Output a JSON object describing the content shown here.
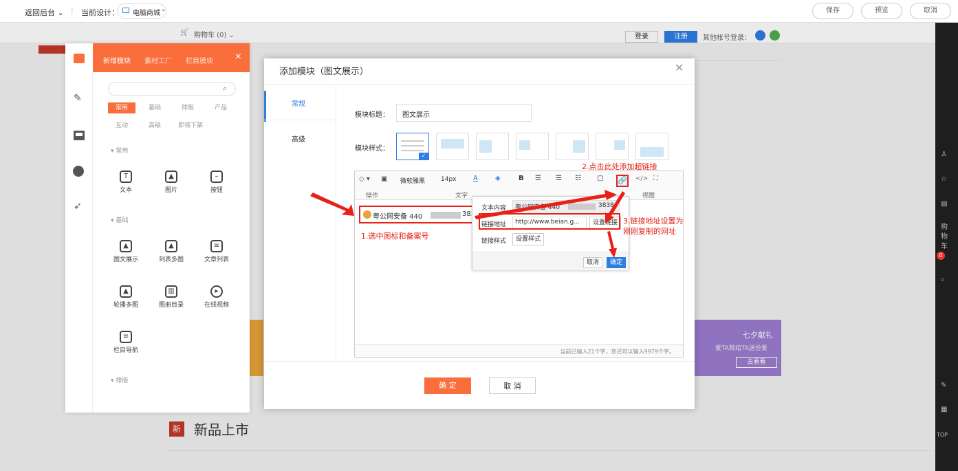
{
  "topbar": {
    "back": "返回后台 ⌄",
    "current_design_label": "当前设计：",
    "current_design_value": "电脑商城",
    "save": "保存",
    "preview": "预览",
    "cancel": "取消"
  },
  "site": {
    "cart": "购物车 (0) ⌄",
    "login": "登录",
    "register": "注册",
    "other_login": "其他帐号登录：",
    "new_products": "新品上市",
    "promo_title": "七夕献礼",
    "promo_sub": "爱TA就给TA送份爱",
    "promo_btn": "去看看"
  },
  "panel": {
    "tabs": [
      "新增模块",
      "素材工厂",
      "栏目模块"
    ],
    "categories": [
      "常用",
      "基础",
      "排版",
      "产品",
      "互动",
      "高级",
      "即将下架"
    ],
    "section_common": "常用",
    "section_basic": "基础",
    "section_layout": "排版",
    "common_modules": [
      "文本",
      "图片",
      "按钮"
    ],
    "basic_modules": [
      "图文展示",
      "列表多图",
      "文章列表",
      "轮播多图",
      "图册目录",
      "在线视频",
      "栏目导航"
    ]
  },
  "rightbar": [
    "购",
    "物",
    "车",
    "0",
    "TOP"
  ],
  "dialog": {
    "title": "添加模块（图文展示）",
    "side_tabs": [
      "常规",
      "高级"
    ],
    "label_title": "模块标题：",
    "title_value": "图文展示",
    "label_style": "模块样式：",
    "toolbar": {
      "font": "微软雅黑",
      "size": "14px",
      "group_ops": "操作",
      "group_text": "文字",
      "group_view": "视图"
    },
    "content_text": "粤公网安备 440",
    "content_tail": "3838",
    "counter": "当前已输入21个字，您还可以输入9979个字。",
    "ok": "确 定",
    "cancel": "取 消"
  },
  "popup": {
    "label_text": "文本内容",
    "text_value": "粤公网安备 440",
    "text_tail": "3838",
    "label_url": "链接地址",
    "url_value": "http://www.beian.g...",
    "set_link": "设置链接",
    "label_style": "链接样式",
    "set_style": "设置样式",
    "cancel": "取消",
    "ok": "确定"
  },
  "annotations": {
    "step1": "1.选中图标和备案号",
    "step2": "2.点击此处添加超链接",
    "step3_line1": "3.链接地址设置为",
    "step3_line2": "刚刚复制的网址"
  },
  "colors": {
    "accent": "#f96e3b",
    "blue": "#2c7ee2",
    "red": "#e62117"
  }
}
